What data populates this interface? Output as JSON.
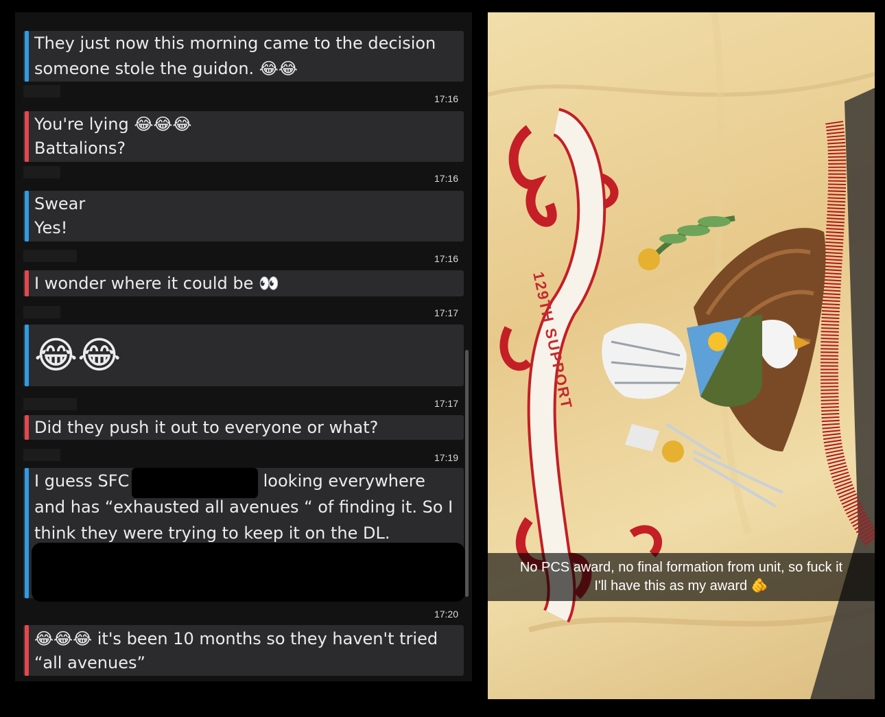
{
  "messages": [
    {
      "lines": [
        "They just now this morning came to the decision",
        "someone stole the guidon. 😂😂"
      ],
      "color": "blue",
      "time": "17:16"
    },
    {
      "lines": [
        "You're lying 😂😂😂",
        "Battalions?"
      ],
      "color": "red",
      "time": "17:16"
    },
    {
      "lines": [
        "Swear",
        "Yes!"
      ],
      "color": "blue",
      "time": "17:16"
    },
    {
      "lines": [
        "I wonder where it could be 👀"
      ],
      "color": "red",
      "time": "17:17"
    },
    {
      "lines": [
        "😂😂"
      ],
      "color": "blue",
      "time": "17:17"
    },
    {
      "lines": [
        "Did they push it out to everyone or what?"
      ],
      "color": "red",
      "time": "17:19"
    },
    {
      "lines": [
        "I guess SFC",
        "looking everywhere",
        "and has “exhausted all avenues “ of finding it. So I",
        "think they were trying to keep it on the DL."
      ],
      "color": "blue",
      "time": "17:20"
    },
    {
      "lines": [
        "😂😂😂 it's been 10 months so they haven't tried",
        "“all avenues”"
      ],
      "color": "red"
    }
  ],
  "photo": {
    "banner_text": "129TH SUPPORT",
    "caption_line1": "No PCS award, no final formation from unit, so fuck it",
    "caption_line2": "I'll have this as my award 🫵"
  }
}
